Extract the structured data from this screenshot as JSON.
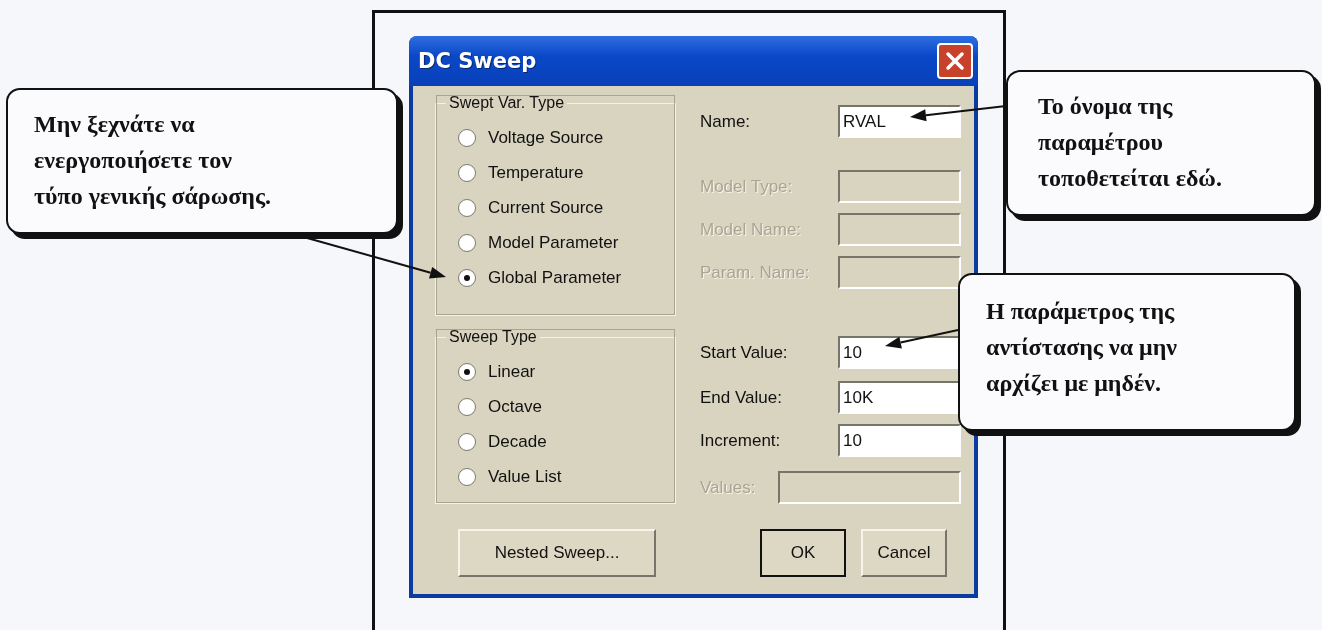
{
  "dialog": {
    "title": "DC Sweep",
    "swept_var_type": {
      "label": "Swept Var. Type",
      "options": [
        {
          "label": "Voltage Source",
          "selected": false
        },
        {
          "label": "Temperature",
          "selected": false
        },
        {
          "label": "Current Source",
          "selected": false
        },
        {
          "label": "Model Parameter",
          "selected": false
        },
        {
          "label": "Global Parameter",
          "selected": true
        }
      ]
    },
    "sweep_type": {
      "label": "Sweep Type",
      "options": [
        {
          "label": "Linear",
          "selected": true
        },
        {
          "label": "Octave",
          "selected": false
        },
        {
          "label": "Decade",
          "selected": false
        },
        {
          "label": "Value List",
          "selected": false
        }
      ]
    },
    "parameter_fields": [
      {
        "label": "Name:",
        "value": "RVAL",
        "disabled": false
      },
      {
        "label": "Model Type:",
        "disabled": true
      },
      {
        "label": "Model Name:",
        "disabled": true
      },
      {
        "label": "Param. Name:",
        "disabled": true
      }
    ],
    "range_fields": [
      {
        "label": "Start Value:",
        "value": "10",
        "disabled": false
      },
      {
        "label": "End Value:",
        "value": "10K",
        "disabled": false
      },
      {
        "label": "Increment:",
        "value": "10",
        "disabled": false
      }
    ],
    "values_field": {
      "label": "Values:",
      "disabled": true
    },
    "buttons": [
      {
        "label": "Nested Sweep...",
        "default": false
      },
      {
        "label": "OK",
        "default": true
      },
      {
        "label": "Cancel",
        "default": false
      }
    ]
  },
  "callouts": [
    {
      "lines": [
        "Μην ξεχνάτε να",
        "ενεργοποιήσετε τον",
        "τύπο γενικής σάρωσης."
      ]
    },
    {
      "lines": [
        "Το όνομα της",
        "παραμέτρου",
        "τοποθετείται εδώ."
      ]
    },
    {
      "lines": [
        "Η παράμετρος της",
        "αντίστασης να μην",
        "αρχίζει με μηδέν."
      ]
    }
  ]
}
